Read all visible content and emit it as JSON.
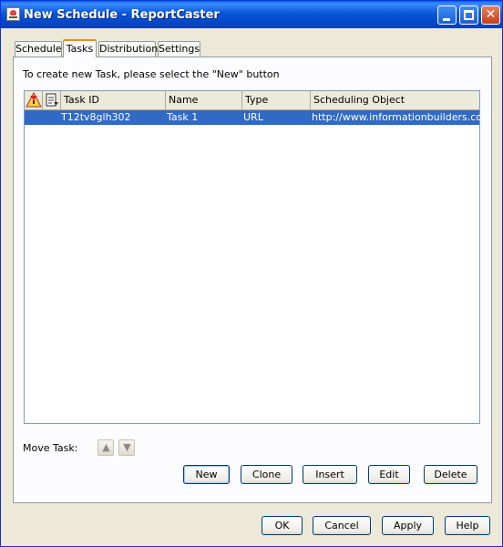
{
  "window": {
    "title": "New Schedule - ReportCaster"
  },
  "tabs": [
    {
      "label": "Schedule",
      "active": false
    },
    {
      "label": "Tasks",
      "active": true
    },
    {
      "label": "Distribution",
      "active": false
    },
    {
      "label": "Settings",
      "active": false
    }
  ],
  "tasks_panel": {
    "instructions": "To create new Task, please select the \"New\" button",
    "table": {
      "columns": [
        "",
        "",
        "Task ID",
        "Name",
        "Type",
        "Scheduling Object"
      ],
      "column_icons": [
        "warning-icon",
        "document-icon"
      ],
      "rows": [
        {
          "task_id": "T12tv8glh302",
          "name": "Task 1",
          "type": "URL",
          "scheduling_object": "http://www.informationbuilders.com",
          "selected": true
        }
      ]
    },
    "move_task_label": "Move Task:",
    "move_up_icon": "arrow-up-icon",
    "move_down_icon": "arrow-down-icon",
    "buttons": {
      "new": "New",
      "clone": "Clone",
      "insert": "Insert",
      "edit": "Edit",
      "delete": "Delete"
    }
  },
  "footer_buttons": {
    "ok": "OK",
    "cancel": "Cancel",
    "apply": "Apply",
    "help": "Help"
  },
  "colors": {
    "title_bar": "#0A57D9",
    "selection": "#316AC5",
    "active_tab_accent": "#E68B2C",
    "dialog_background": "#ECE9D8"
  }
}
